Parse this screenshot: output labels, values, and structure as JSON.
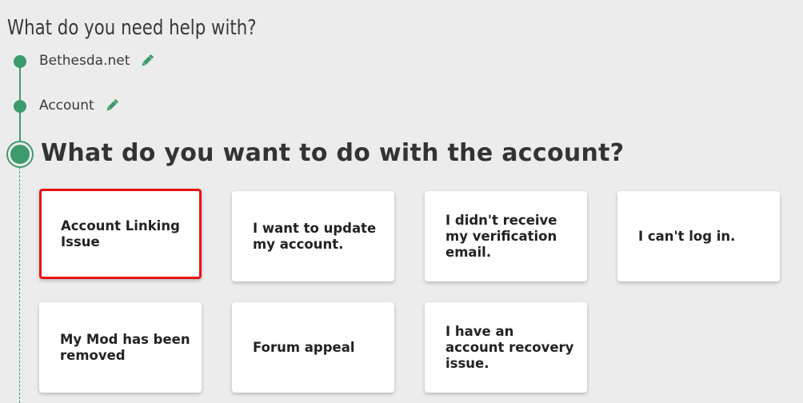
{
  "header": {
    "title": "What do you need help with?"
  },
  "breadcrumb_steps": [
    {
      "label": "Bethesda.net",
      "icon": "pencil-icon"
    },
    {
      "label": "Account",
      "icon": "pencil-icon"
    }
  ],
  "question": "What do you want to do with the account?",
  "options": [
    {
      "label": "Account Linking Issue",
      "selected": true
    },
    {
      "label": "I want to update my account.",
      "selected": false
    },
    {
      "label": "I didn't receive my verification email.",
      "selected": false
    },
    {
      "label": "I can't log in.",
      "selected": false
    },
    {
      "label": "My Mod has been removed",
      "selected": false
    },
    {
      "label": "Forum appeal",
      "selected": false
    },
    {
      "label": "I have an account recovery issue.",
      "selected": false
    }
  ],
  "colors": {
    "accent": "#3d9a6d",
    "selected_border": "#e81414",
    "background": "#ececec",
    "card": "#ffffff"
  }
}
